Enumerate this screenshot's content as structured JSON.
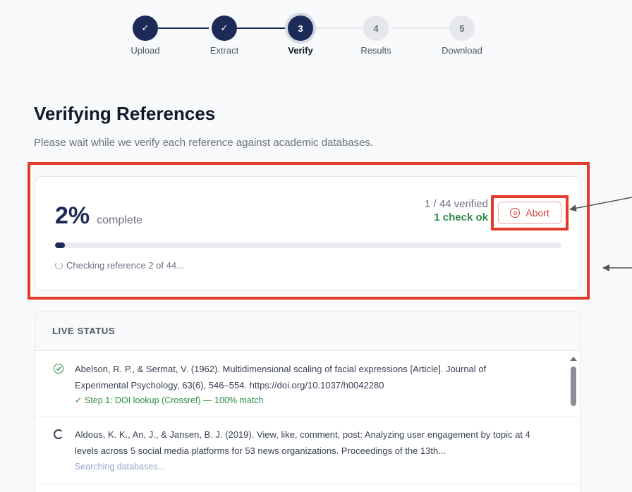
{
  "stepper": {
    "steps": [
      {
        "num": "✓",
        "label": "Upload",
        "state": "done"
      },
      {
        "num": "✓",
        "label": "Extract",
        "state": "done"
      },
      {
        "num": "3",
        "label": "Verify",
        "state": "active"
      },
      {
        "num": "4",
        "label": "Results",
        "state": "todo"
      },
      {
        "num": "5",
        "label": "Download",
        "state": "todo"
      }
    ]
  },
  "header": {
    "title": "Verifying References",
    "subtitle": "Please wait while we verify each reference against academic databases."
  },
  "progress": {
    "percent": "2%",
    "percent_value": 2,
    "complete_label": "complete",
    "verified_count": "1 / 44 verified",
    "checks_ok": "1 check ok",
    "abort_label": "Abort",
    "checking_text": "Checking reference 2 of 44..."
  },
  "live_status": {
    "heading": "LIVE STATUS",
    "items": [
      {
        "status": "verified",
        "text": "Abelson, R. P., & Sermat, V. (1962). Multidimensional scaling of facial expressions [Article]. Journal of Experimental Psychology, 63(6), 546–554. https://doi.org/10.1037/h0042280",
        "step": "✓ Step 1: DOI lookup (Crossref) — 100% match"
      },
      {
        "status": "searching",
        "text": "Aldous, K. K., An, J., & Jansen, B. J. (2019). View, like, comment, post: Analyzing user engagement by topic at 4 levels across 5 social media platforms for 53 news organizations. Proceedings of the 13th...",
        "step": "Searching databases..."
      }
    ]
  },
  "colors": {
    "primary": "#1b2a57",
    "success": "#2f8a4a",
    "danger": "#d93a3a",
    "annotation": "#e33a2a"
  }
}
